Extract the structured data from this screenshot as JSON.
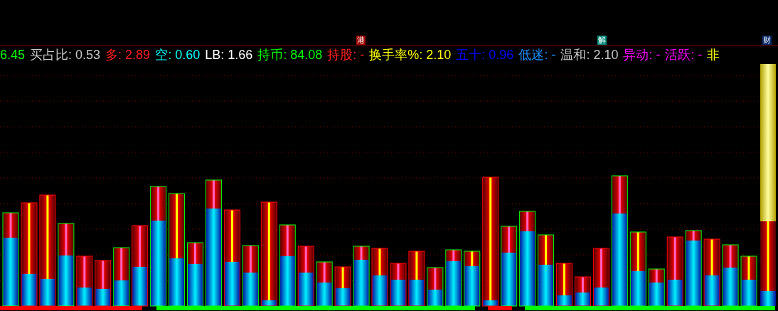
{
  "event_tags": [
    {
      "text": "港",
      "color": "#a00000"
    },
    {
      "text": "解",
      "color": "#008878"
    },
    {
      "text": "财",
      "color": "#0a2a6a"
    }
  ],
  "indicators": [
    {
      "value": "6.45",
      "color": "#00ff00"
    },
    {
      "label": "买占比:",
      "value": "0.53",
      "color": "#c8c8c8"
    },
    {
      "label": "多:",
      "value": "2.89",
      "color": "#ff2020"
    },
    {
      "label": "空:",
      "value": "0.60",
      "color": "#00ffff"
    },
    {
      "label": "LB:",
      "value": "1.66",
      "color": "#ffffff"
    },
    {
      "label": "持币:",
      "value": "84.08",
      "color": "#00ff00"
    },
    {
      "label": "持股:",
      "value": "-",
      "color": "#ff2020"
    },
    {
      "label": "换手率%:",
      "value": "2.10",
      "color": "#ffff00"
    },
    {
      "label": "五十:",
      "value": "0.96",
      "color": "#0000ff"
    },
    {
      "label": "低迷:",
      "value": "-",
      "color": "#1e90ff"
    },
    {
      "label": "温和:",
      "value": "2.10",
      "color": "#c8c8c8"
    },
    {
      "label": "异动:",
      "value": "-",
      "color": "#ff00ff"
    },
    {
      "label": "活跃:",
      "value": "-",
      "color": "#ff00ff"
    },
    {
      "label": "非",
      "color": "#ffff00"
    }
  ]
}
